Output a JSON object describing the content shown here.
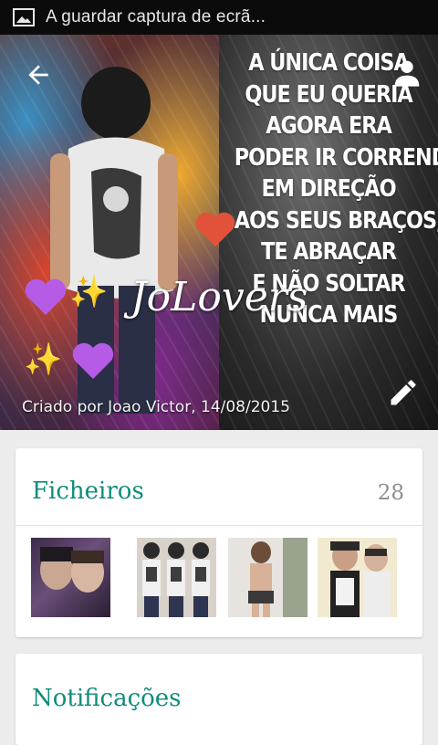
{
  "status_bar": {
    "text": "A guardar captura de ecrã..."
  },
  "header": {
    "group_name": "JoLovers",
    "created_by": "Criado por Joao Victor, 14/08/2015",
    "quote_lines": [
      "A ÚNICA COISA",
      "QUE EU QUERIA",
      "AGORA ERA",
      "PODER IR CORRENDO",
      "EM DIREÇÃO",
      "AOS SEUS BRAÇOS,",
      "TE ABRAÇAR",
      "E NÃO SOLTAR",
      "NUNCA MAIS"
    ],
    "icons": {
      "back": "arrow-back-icon",
      "profile": "person-icon",
      "edit": "pencil-icon"
    }
  },
  "files": {
    "title": "Ficheiros",
    "count": "28"
  },
  "notifications": {
    "title": "Notificações"
  },
  "colors": {
    "accent": "#0f8c7a",
    "count": "#8e8e8e",
    "status_bar": "#0b0b0b"
  }
}
